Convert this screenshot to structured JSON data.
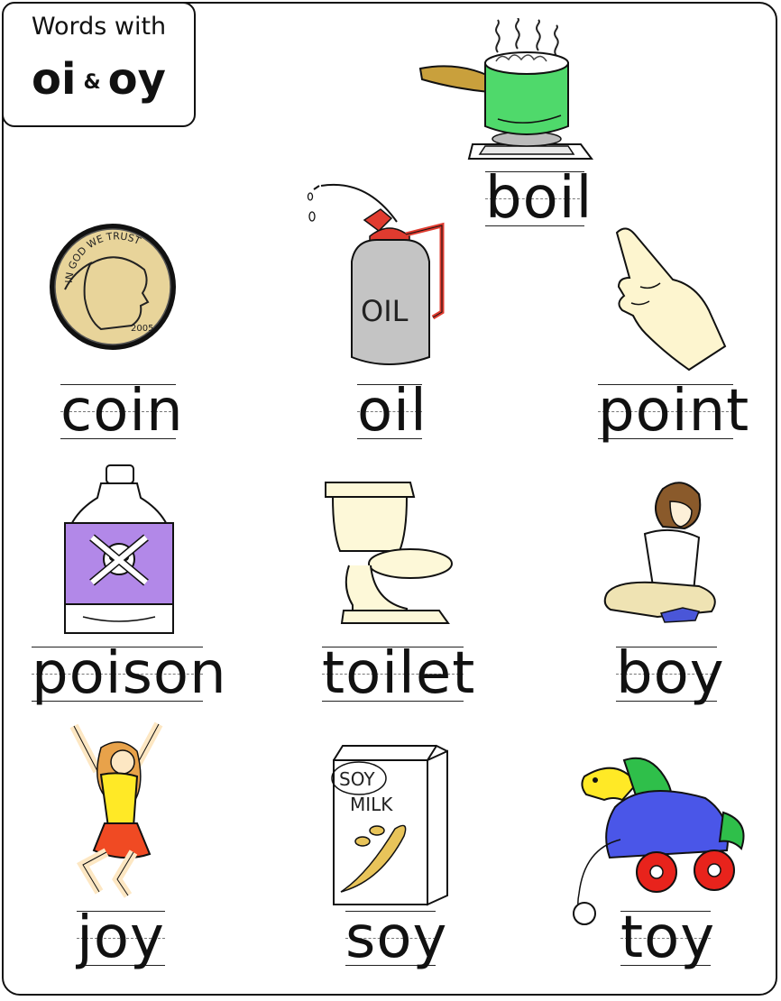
{
  "title": {
    "line1": "Words with",
    "oi": "oi",
    "amp": "&",
    "oy": "oy"
  },
  "words": {
    "boil": "boil",
    "coin": "coin",
    "oil": "oil",
    "point": "point",
    "poison": "poison",
    "toilet": "toilet",
    "boy": "boy",
    "joy": "joy",
    "soy": "soy",
    "toy": "toy"
  },
  "coin": {
    "motto": "IN GOD WE TRUST",
    "year": "2005"
  },
  "can": {
    "label": "OIL"
  },
  "carton": {
    "line1": "SOY",
    "line2": "MILK"
  }
}
